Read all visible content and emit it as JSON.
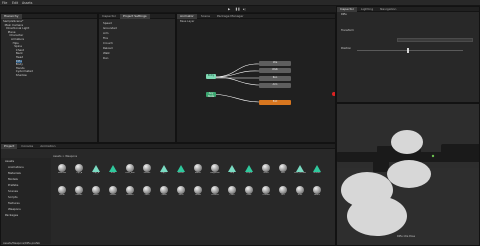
{
  "window": {
    "title": "Unity Editor"
  },
  "menubar": {
    "items": [
      "File",
      "Edit",
      "Assets",
      "GameObject",
      "Component",
      "Window",
      "Help"
    ]
  },
  "hierarchy": {
    "tabs": [
      "Hierarchy"
    ],
    "rows": [
      "SampleScene*",
      "Main Camera",
      "Directional Light",
      "Plane",
      "Character",
      "Armature",
      "Hips",
      "Spine",
      "Chest",
      "Neck",
      "Head",
      "Rifle",
      "Body",
      "Hands",
      "CyAnimated",
      "Shadow"
    ]
  },
  "inspector_left": {
    "tabs": [
      "Inspector",
      "Project Settings"
    ],
    "items": [
      "Speed",
      "Grounded",
      "Aim",
      "Fire",
      "Crouch",
      "Reload",
      "Walk",
      "Run"
    ]
  },
  "animator": {
    "tabs": [
      "Animator",
      "Scene",
      "Package Manager"
    ],
    "header": "Base Layer",
    "nodes": {
      "entry": "Entry",
      "idle": "Idle",
      "walk": "Walk",
      "run": "Run",
      "aim": "Aim",
      "any": "Any State",
      "exit": "Exit"
    }
  },
  "inspector_right": {
    "tabs": [
      "Inspector",
      "Lighting",
      "Navigation"
    ],
    "title": "Rifle",
    "component": "Transform",
    "slider_label": "Position",
    "slider_value": 0.48
  },
  "scene_view": {
    "caption": "Rifle Idle Pose"
  },
  "project": {
    "tabs": [
      "Project",
      "Console",
      "Animation"
    ],
    "breadcrumb": "Assets > Weapons",
    "folders": [
      "Assets",
      "Animations",
      "Materials",
      "Models",
      "Prefabs",
      "Scenes",
      "Scripts",
      "Textures",
      "Weapons",
      "Packages"
    ],
    "assets_row1": [
      "Material",
      "Clip_A",
      "Clip_B",
      "Rifle",
      "Rifle_Mat",
      "Soldier",
      "Clip_C",
      "Bullet",
      "Barrel",
      "Magazine",
      "Grip",
      "Scope",
      "Stock",
      "Box",
      "Rifle_Prefab",
      "Muzzle"
    ],
    "assets_row2": [
      "Metal",
      "Metal2",
      "Anim",
      "Plastic",
      "Rubber",
      "Shell",
      "Glass",
      "Steel",
      "Wood",
      "Leather",
      "Cloth",
      "Paint",
      "Chrome",
      "Dirt",
      "Rust",
      "Fabric"
    ],
    "footer": "Assets/Weapons/Rifle.prefab"
  },
  "colors": {
    "accent": "#2c5d87",
    "entry": "#2c8a5c",
    "state": "#5e5e5e",
    "default_state": "#d8761f",
    "any": "#3aa56f"
  }
}
